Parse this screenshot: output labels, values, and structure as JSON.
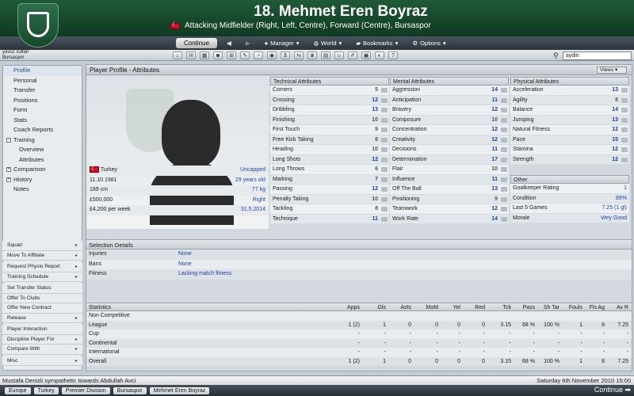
{
  "header": {
    "player_name": "18. Mehmet Eren Boyraz",
    "position_line": "Attacking Midfielder (Right, Left, Centre), Forward (Centre), Bursaspor"
  },
  "nav": {
    "continue": "Continue",
    "back": "◀",
    "forward": "▶",
    "manager": "Manager",
    "world": "World",
    "bookmarks": "Bookmarks",
    "options": "Options"
  },
  "user": {
    "name": "yavuz sultan",
    "club": "Bursaspor"
  },
  "search": {
    "value": "aydin"
  },
  "sidebar": {
    "items": [
      {
        "label": "Profile"
      },
      {
        "label": "Personal"
      },
      {
        "label": "Transfer"
      },
      {
        "label": "Positions"
      },
      {
        "label": "Form"
      },
      {
        "label": "Stats"
      },
      {
        "label": "Coach Reports"
      },
      {
        "label": "Training"
      },
      {
        "label": "Overview"
      },
      {
        "label": "Attributes"
      },
      {
        "label": "Comparison"
      },
      {
        "label": "History"
      },
      {
        "label": "Notes"
      }
    ]
  },
  "actions": [
    "Squad",
    "Move To Affiliate",
    "Request Physio Report",
    "Training Schedule",
    "Set Transfer Status",
    "Offer To Clubs",
    "Offer New Contract",
    "Release",
    "Player Interaction",
    "Discipline Player For",
    "Compare With",
    "Misc"
  ],
  "panel": {
    "title": "Player Profile - Attributes",
    "views": "Views"
  },
  "profile": {
    "nation": "Turkey",
    "caps": "Uncapped",
    "dob": "11.10.1981",
    "age": "29 years old",
    "height": "189 cm",
    "weight": "77 kg",
    "value": "£500,000",
    "foot": "Right",
    "wage": "£4,200 per week",
    "contract": "31.5.2014"
  },
  "technical": {
    "title": "Technical Attributes",
    "rows": [
      [
        "Corners",
        "5"
      ],
      [
        "Crossing",
        "12"
      ],
      [
        "Dribbling",
        "13"
      ],
      [
        "Finishing",
        "10"
      ],
      [
        "First Touch",
        "9"
      ],
      [
        "Free Kick Taking",
        "8"
      ],
      [
        "Heading",
        "10"
      ],
      [
        "Long Shots",
        "12"
      ],
      [
        "Long Throws",
        "6"
      ],
      [
        "Marking",
        "7"
      ],
      [
        "Passing",
        "12"
      ],
      [
        "Penalty Taking",
        "10"
      ],
      [
        "Tackling",
        "8"
      ],
      [
        "Technique",
        "11"
      ]
    ]
  },
  "mental": {
    "title": "Mental Attributes",
    "rows": [
      [
        "Aggression",
        "14"
      ],
      [
        "Anticipation",
        "11"
      ],
      [
        "Bravery",
        "12"
      ],
      [
        "Composure",
        "10"
      ],
      [
        "Concentration",
        "12"
      ],
      [
        "Creativity",
        "12"
      ],
      [
        "Decisions",
        "11"
      ],
      [
        "Determination",
        "17"
      ],
      [
        "Flair",
        "10"
      ],
      [
        "Influence",
        "11"
      ],
      [
        "Off The Ball",
        "13"
      ],
      [
        "Positioning",
        "9"
      ],
      [
        "Teamwork",
        "12"
      ],
      [
        "Work Rate",
        "14"
      ]
    ]
  },
  "physical": {
    "title": "Physical Attributes",
    "rows": [
      [
        "Acceleration",
        "13"
      ],
      [
        "Agility",
        "8"
      ],
      [
        "Balance",
        "14"
      ],
      [
        "Jumping",
        "13"
      ],
      [
        "Natural Fitness",
        "12"
      ],
      [
        "Pace",
        "15"
      ],
      [
        "Stamina",
        "12"
      ],
      [
        "Strength",
        "12"
      ]
    ]
  },
  "other": {
    "title": "Other",
    "rows": [
      [
        "Goalkeeper Rating",
        "1"
      ],
      [
        "Condition",
        "89%"
      ],
      [
        "Last 5 Games",
        "7.25 (1 gl)"
      ],
      [
        "Morale",
        "Very Good"
      ]
    ]
  },
  "selection": {
    "title": "Selection Details",
    "rows": [
      [
        "Injuries",
        "None"
      ],
      [
        "Bans",
        "None"
      ],
      [
        "Fitness",
        "Lacking match fitness"
      ]
    ]
  },
  "stats": {
    "title": "Statistics",
    "headers": [
      "Apps",
      "Gls",
      "Asts",
      "MoM",
      "Yel",
      "Red",
      "Tck",
      "Pass",
      "Sh Tar",
      "Fouls",
      "Fls Ag",
      "Av R"
    ],
    "rows": [
      {
        "name": "Non Competitive",
        "values": [
          "",
          "",
          "",
          "",
          "",
          "",
          "",
          "",
          "",
          "",
          "",
          ""
        ]
      },
      {
        "name": "League",
        "values": [
          "1 (2)",
          "1",
          "0",
          "0",
          "0",
          "0",
          "3.15",
          "68 %",
          "100 %",
          "1",
          "8",
          "7.25"
        ]
      },
      {
        "name": "Cup",
        "values": [
          "-",
          "-",
          "-",
          "-",
          "-",
          "-",
          "-",
          "-",
          "-",
          "-",
          "-",
          "-"
        ]
      },
      {
        "name": "Continental",
        "values": [
          "-",
          "-",
          "-",
          "-",
          "-",
          "-",
          "-",
          "-",
          "-",
          "-",
          "-",
          "-"
        ]
      },
      {
        "name": "International",
        "values": [
          "-",
          "-",
          "-",
          "-",
          "-",
          "-",
          "-",
          "-",
          "-",
          "-",
          "-",
          "-"
        ]
      },
      {
        "name": "Overall",
        "values": [
          "1 (2)",
          "1",
          "0",
          "0",
          "0",
          "0",
          "3.15",
          "68 %",
          "100 %",
          "1",
          "8",
          "7.25"
        ]
      }
    ]
  },
  "news": {
    "text": "Mustafa Denizli sympathetic towards Abdullah Avci",
    "date": "Saturday 6th November 2010 15:00"
  },
  "breadcrumb": [
    "Europe",
    "Turkey",
    "Premier Division",
    "Bursaspor",
    "Mehmet Eren Boyraz"
  ],
  "footer": {
    "continue": "Continue"
  }
}
